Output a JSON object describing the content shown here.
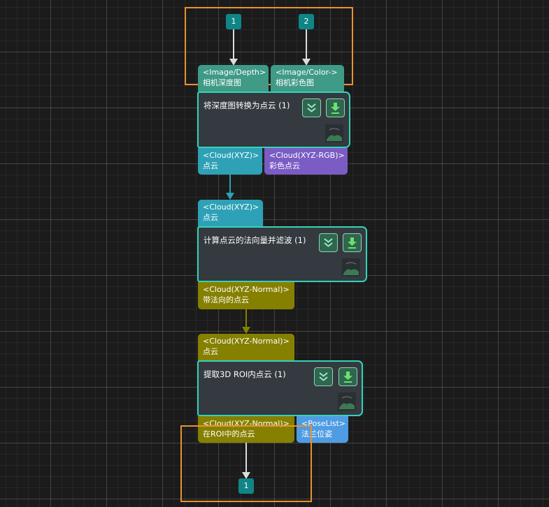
{
  "inputs": [
    {
      "badge": "1",
      "port_type": "<Image/Depth>",
      "port_label": "相机深度图"
    },
    {
      "badge": "2",
      "port_type": "<Image/Color->",
      "port_label": "相机彩色图"
    }
  ],
  "steps": [
    {
      "title": "将深度图转换为点云 (1)",
      "outputs": [
        {
          "type": "<Cloud(XYZ)>",
          "label": "点云"
        },
        {
          "type": "<Cloud(XYZ-RGB)>",
          "label": "彩色点云"
        }
      ]
    },
    {
      "title": "计算点云的法向量并滤波 (1)",
      "inputs": [
        {
          "type": "<Cloud(XYZ)>",
          "label": "点云"
        }
      ],
      "outputs": [
        {
          "type": "<Cloud(XYZ-Normal)>",
          "label": "带法向的点云"
        }
      ]
    },
    {
      "title": "提取3D ROI内点云 (1)",
      "inputs": [
        {
          "type": "<Cloud(XYZ-Normal)>",
          "label": "点云"
        }
      ],
      "outputs": [
        {
          "type": "<Cloud(XYZ-Normal)>",
          "label": "在ROI中的点云"
        },
        {
          "type": "<PoseList>",
          "label": "法兰位姿"
        }
      ]
    }
  ],
  "outputs": [
    {
      "badge": "1"
    }
  ],
  "colors": {
    "background": "#1b1b1b",
    "group_border": "#e8922e",
    "step_border": "#34d3b9",
    "step_body": "#343a3f",
    "badge": "#0f8585",
    "image_port": "#3f9a86",
    "cloud_xyz_port": "#2ea1b6",
    "cloud_rgb_port": "#7a5cc4",
    "cloud_normal_port": "#858000",
    "poselist_port": "#4e9ce3"
  },
  "icons": {
    "step_buttons": [
      "double-chevron-down-icon",
      "download-arrow-icon"
    ],
    "step_thumbnail": "landscape-thumbnail-icon"
  }
}
